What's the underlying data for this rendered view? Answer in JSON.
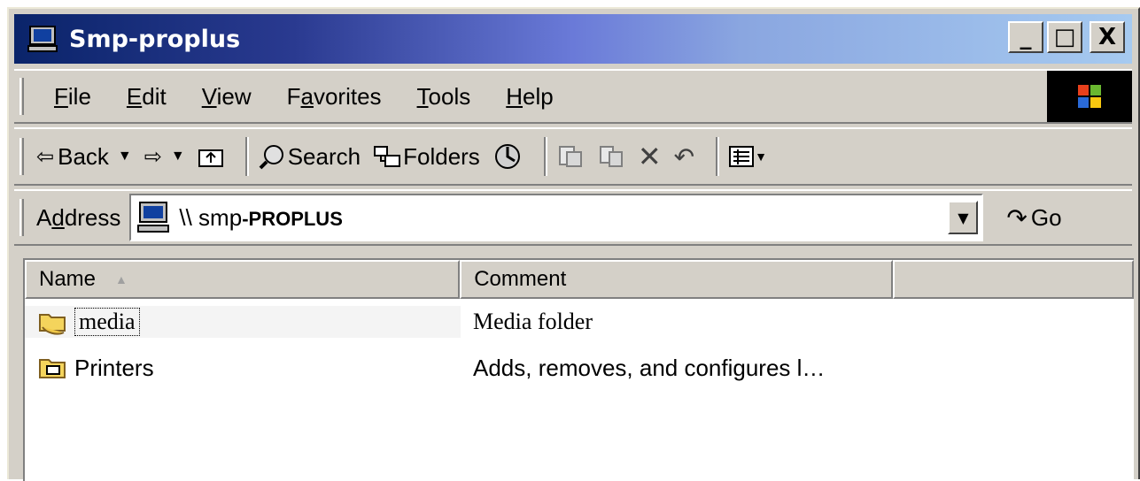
{
  "window": {
    "title": "Smp-proplus",
    "minimize": "_",
    "maximize": "□",
    "close": "X"
  },
  "menu": {
    "items": [
      {
        "label_u": "F",
        "label_rest": "ile"
      },
      {
        "label_u": "E",
        "label_rest": "dit"
      },
      {
        "label_u": "V",
        "label_rest": "iew"
      },
      {
        "label_pre": "F",
        "label_u": "a",
        "label_rest": "vorites"
      },
      {
        "label_u": "T",
        "label_rest": "ools"
      },
      {
        "label_u": "H",
        "label_rest": "elp"
      }
    ]
  },
  "toolbar": {
    "back": "Back",
    "search": "Search",
    "folders": "Folders"
  },
  "address": {
    "label_pre": "A",
    "label_u": "d",
    "label_rest": "dress",
    "value_prefix": "\\\\ smp",
    "value_suffix": "-PROPLUS",
    "go": "Go"
  },
  "list": {
    "columns": [
      "Name",
      "Comment"
    ],
    "rows": [
      {
        "name": "media",
        "comment": "Media folder",
        "icon": "shared-folder-icon"
      },
      {
        "name": "Printers",
        "comment": "Adds, removes, and configures l…",
        "icon": "printers-folder-icon"
      }
    ]
  }
}
